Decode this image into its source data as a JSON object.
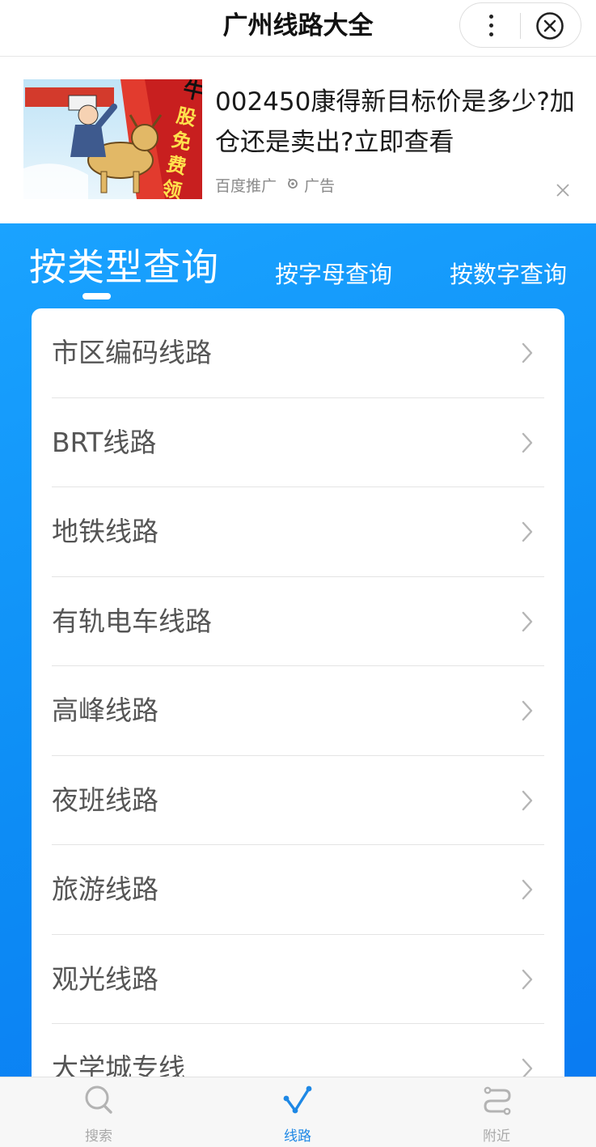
{
  "header": {
    "title": "广州线路大全"
  },
  "ad": {
    "headline": "002450康得新目标价是多少?加仓还是卖出?立即查看",
    "source": "百度推广",
    "tag": "广告",
    "image_text": "牛股免费领"
  },
  "tabs": [
    {
      "label": "按类型查询",
      "active": true
    },
    {
      "label": "按字母查询",
      "active": false
    },
    {
      "label": "按数字查询",
      "active": false
    }
  ],
  "routes": [
    {
      "label": "市区编码线路"
    },
    {
      "label": "BRT线路"
    },
    {
      "label": "地铁线路"
    },
    {
      "label": "有轨电车线路"
    },
    {
      "label": "高峰线路"
    },
    {
      "label": "夜班线路"
    },
    {
      "label": "旅游线路"
    },
    {
      "label": "观光线路"
    },
    {
      "label": "大学城专线"
    }
  ],
  "tabbar": [
    {
      "label": "搜索",
      "icon": "search-icon",
      "active": false
    },
    {
      "label": "线路",
      "icon": "route-icon",
      "active": true
    },
    {
      "label": "附近",
      "icon": "nearby-icon",
      "active": false
    }
  ],
  "colors": {
    "panel_blue": "#0d8df5",
    "active_tab": "#1e88e5",
    "inactive_tab": "#a9a9a9"
  }
}
